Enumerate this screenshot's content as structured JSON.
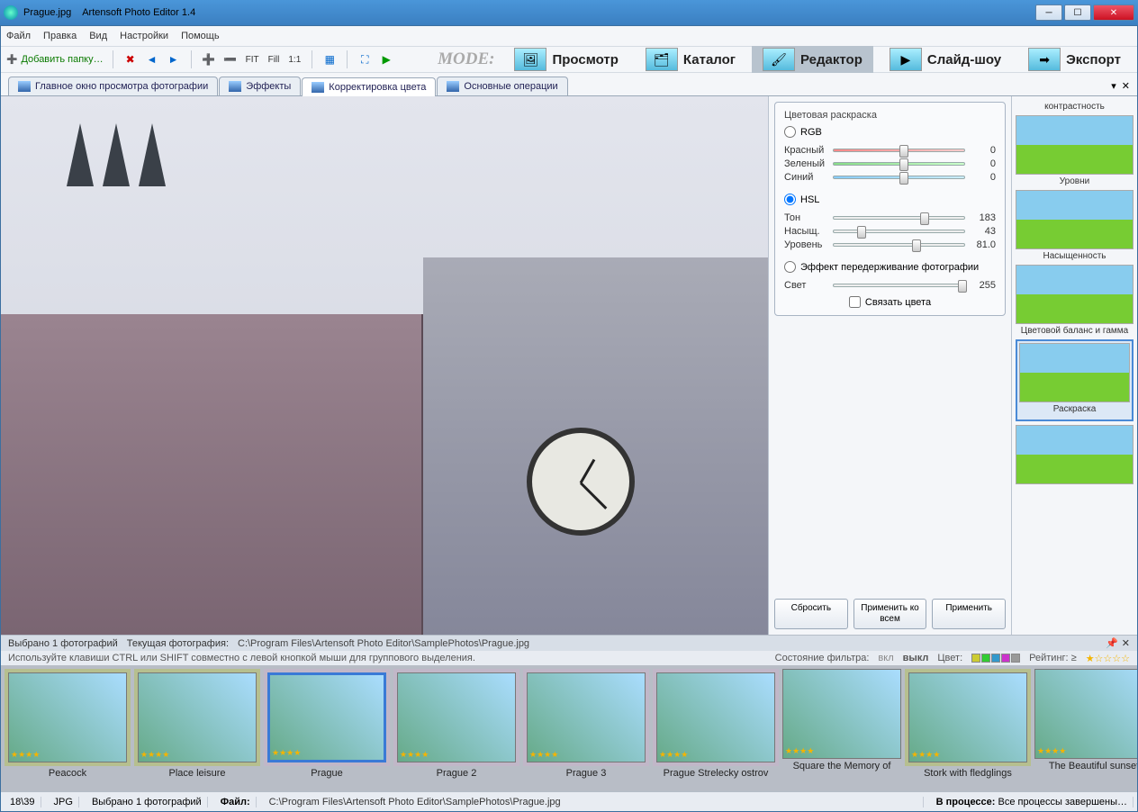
{
  "title": {
    "file": "Prague.jpg",
    "app": "Artensoft Photo Editor 1.4"
  },
  "menu": [
    "Файл",
    "Правка",
    "Вид",
    "Настройки",
    "Помощь"
  ],
  "toolbar": {
    "add_folder": "Добавить папку…",
    "fit": "FIT",
    "fill": "Fill",
    "oneone": "1:1"
  },
  "mode_label": "MODE:",
  "modes": [
    {
      "label": "Просмотр",
      "active": false
    },
    {
      "label": "Каталог",
      "active": false
    },
    {
      "label": "Редактор",
      "active": true
    },
    {
      "label": "Слайд-шоу",
      "active": false
    },
    {
      "label": "Экспорт",
      "active": false
    }
  ],
  "tabs": [
    {
      "label": "Главное окно просмотра фотографии",
      "active": false
    },
    {
      "label": "Эффекты",
      "active": false
    },
    {
      "label": "Корректировка цвета",
      "active": true
    },
    {
      "label": "Основные операции",
      "active": false
    }
  ],
  "color_panel": {
    "title": "Цветовая раскраска",
    "rgb_label": "RGB",
    "rgb_selected": false,
    "rgb": [
      {
        "label": "Красный",
        "value": "0",
        "pct": 50,
        "color": "red"
      },
      {
        "label": "Зеленый",
        "value": "0",
        "pct": 50,
        "color": "green"
      },
      {
        "label": "Синий",
        "value": "0",
        "pct": 50,
        "color": "blue"
      }
    ],
    "hsl_label": "HSL",
    "hsl_selected": true,
    "hsl": [
      {
        "label": "Тон",
        "value": "183",
        "pct": 66
      },
      {
        "label": "Насыщ.",
        "value": "43",
        "pct": 18
      },
      {
        "label": "Уровень",
        "value": "81.0",
        "pct": 60
      }
    ],
    "overexpose_label": "Эффект передерживание фотографии",
    "overexpose_selected": false,
    "light": {
      "label": "Свет",
      "value": "255",
      "pct": 95
    },
    "link_colors": "Связать цвета",
    "btn_reset": "Сбросить",
    "btn_apply_all": "Применить ко всем",
    "btn_apply": "Применить"
  },
  "preset_col": {
    "top": "контрастность",
    "items": [
      "Уровни",
      "Насыщенность",
      "Цветовой баланс и гамма",
      "Раскраска",
      ""
    ]
  },
  "info": {
    "selected": "Выбрано 1  фотографий",
    "current_label": "Текущая фотография:",
    "current_path": "C:\\Program Files\\Artensoft Photo Editor\\SamplePhotos\\Prague.jpg"
  },
  "hint": "Используйте клавиши CTRL или SHIFT совместно с левой кнопкой мыши для группового выделения.",
  "filter": {
    "state_label": "Состояние фильтра:",
    "on": "вкл",
    "off": "выкл",
    "color_label": "Цвет:",
    "rating_label": "Рейтинг: ≥"
  },
  "filmstrip": [
    {
      "label": "Peacock",
      "bg": "olive",
      "sel": false
    },
    {
      "label": "Place leisure",
      "bg": "olive",
      "sel": false
    },
    {
      "label": "Prague",
      "bg": "mauve",
      "sel": true
    },
    {
      "label": "Prague 2",
      "bg": "mauve",
      "sel": false
    },
    {
      "label": "Prague 3",
      "bg": "mauve",
      "sel": false
    },
    {
      "label": "Prague Strelecky ostrov",
      "bg": "mauve",
      "sel": false
    },
    {
      "label": "Square the Memory of",
      "bg": "",
      "sel": false
    },
    {
      "label": "Stork with fledglings",
      "bg": "olive",
      "sel": false
    },
    {
      "label": "The Beautiful sunset",
      "bg": "",
      "sel": false
    }
  ],
  "status": {
    "counter": "18\\39",
    "format": "JPG",
    "selected": "Выбрано 1 фотографий",
    "file_label": "Файл:",
    "file_path": "C:\\Program Files\\Artensoft Photo Editor\\SamplePhotos\\Prague.jpg",
    "proc_label": "В процессе:",
    "proc_value": "Все процессы завершены…"
  }
}
